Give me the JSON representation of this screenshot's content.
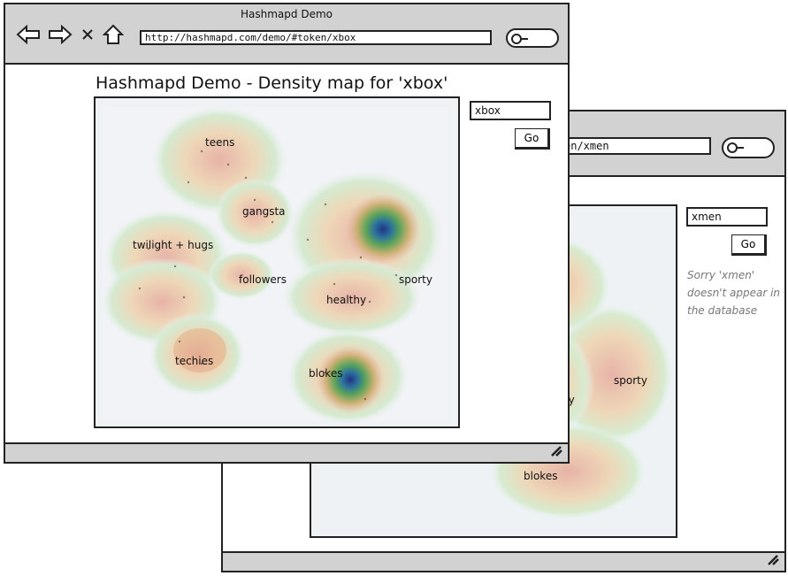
{
  "front": {
    "window_title": "Hashmapd Demo",
    "url": "http://hashmapd.com/demo/#token/xbox",
    "heading": "Hashmapd Demo - Density map for 'xbox'",
    "search_value": "xbox",
    "go_label": "Go",
    "map_labels": [
      "teens",
      "gangsta",
      "twilight + hugs",
      "followers",
      "healthy",
      "sporty",
      "techies",
      "blokes"
    ]
  },
  "back": {
    "url": "en/xmen",
    "search_value": "xmen",
    "go_label": "Go",
    "message": "Sorry 'xmen' doesn't appear in the database",
    "map_labels": [
      "sporty",
      "hy",
      "blokes"
    ]
  },
  "icons": [
    "back-arrow-icon",
    "forward-arrow-icon",
    "close-icon",
    "home-icon",
    "search-icon",
    "resize-grip-icon"
  ],
  "colors": {
    "chrome": "#d2d2d2",
    "density_high": "#2b4aa0",
    "density_mid": "#6aa84f",
    "density_low": "#e8b0a8"
  }
}
